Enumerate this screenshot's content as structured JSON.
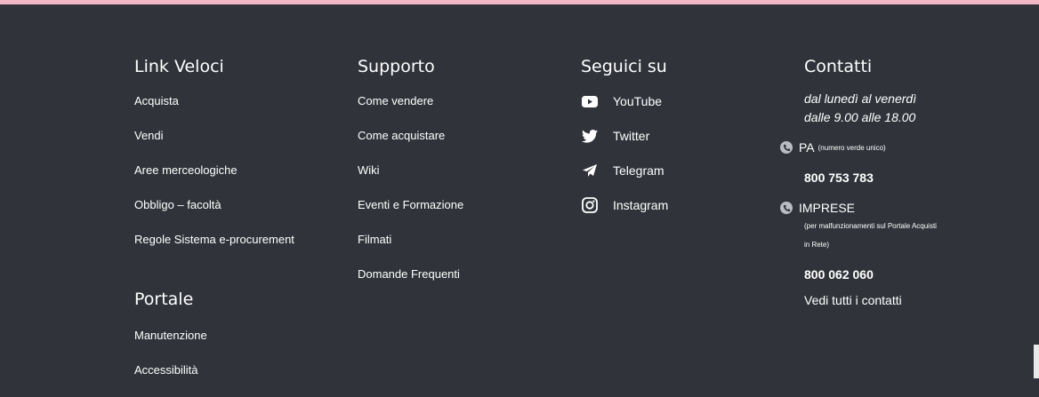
{
  "link_veloci": {
    "title": "Link Veloci",
    "items": [
      "Acquista",
      "Vendi",
      "Aree merceologiche",
      "Obbligo – facoltà",
      "Regole Sistema e-procurement"
    ]
  },
  "portale": {
    "title": "Portale",
    "items": [
      "Manutenzione",
      "Accessibilità"
    ]
  },
  "supporto": {
    "title": "Supporto",
    "items": [
      "Come vendere",
      "Come acquistare",
      "Wiki",
      "Eventi e Formazione",
      "Filmati",
      "Domande Frequenti"
    ]
  },
  "seguici": {
    "title": "Seguici su",
    "items": [
      {
        "label": "YouTube",
        "icon": "youtube-icon"
      },
      {
        "label": "Twitter",
        "icon": "twitter-icon"
      },
      {
        "label": "Telegram",
        "icon": "telegram-icon"
      },
      {
        "label": "Instagram",
        "icon": "instagram-icon"
      }
    ]
  },
  "contatti": {
    "title": "Contatti",
    "hours_line1": "dal lunedì al venerdì",
    "hours_line2": "dalle 9.00 alle 18.00",
    "pa_label": "PA",
    "pa_note": "(numero verde unico)",
    "pa_number": "800 753 783",
    "imprese_label": "IMPRESE",
    "imprese_note": "(per malfunzionamenti sul Portale Acquisti in Rete)",
    "imprese_number": "800 062 060",
    "all_contacts": "Vedi tutti i contatti"
  },
  "colors": {
    "background": "#30343a",
    "top_strip": "#f2b8c6",
    "text": "#ffffff",
    "phone_icon": "#b9bcc1"
  }
}
